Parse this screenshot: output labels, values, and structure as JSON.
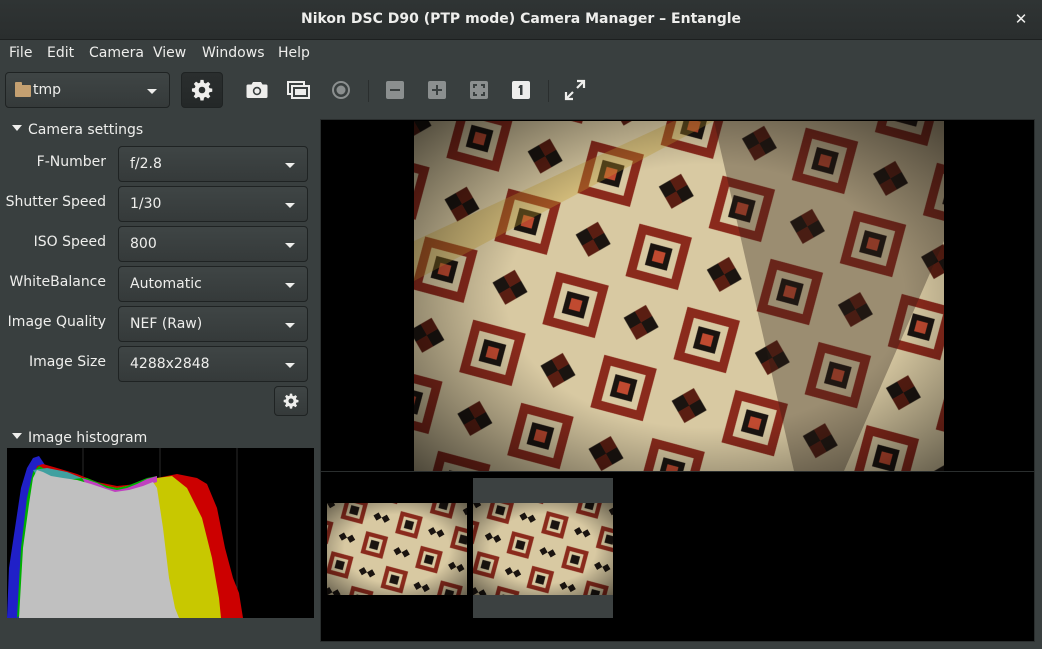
{
  "window": {
    "title": "Nikon DSC D90 (PTP mode) Camera Manager – Entangle",
    "close_icon": "close-icon"
  },
  "menu": [
    "File",
    "Edit",
    "Camera",
    "View",
    "Windows",
    "Help"
  ],
  "toolbar": {
    "folder": "tmp",
    "buttons": [
      {
        "name": "settings-gear-icon",
        "active": true
      },
      {
        "name": "camera-capture-icon"
      },
      {
        "name": "preview-icon"
      },
      {
        "name": "record-icon"
      },
      {
        "name": "zoom-out-icon"
      },
      {
        "name": "zoom-in-icon"
      },
      {
        "name": "zoom-fit-icon"
      },
      {
        "name": "zoom-actual-icon"
      },
      {
        "name": "fullscreen-icon"
      }
    ]
  },
  "camera_settings": {
    "header": "Camera settings",
    "rows": [
      {
        "label": "F-Number",
        "value": "f/2.8"
      },
      {
        "label": "Shutter Speed",
        "value": "1/30"
      },
      {
        "label": "ISO Speed",
        "value": "800"
      },
      {
        "label": "WhiteBalance",
        "value": "Automatic"
      },
      {
        "label": "Image Quality",
        "value": "NEF (Raw)"
      },
      {
        "label": "Image Size",
        "value": "4288x2848"
      }
    ]
  },
  "histogram": {
    "header": "Image histogram"
  },
  "colors": {
    "window_bg": "#393f3f",
    "titlebar_bg": "#2f3434",
    "viewer_bg": "#000000",
    "selected_thumb_bg": "#3c4141"
  }
}
